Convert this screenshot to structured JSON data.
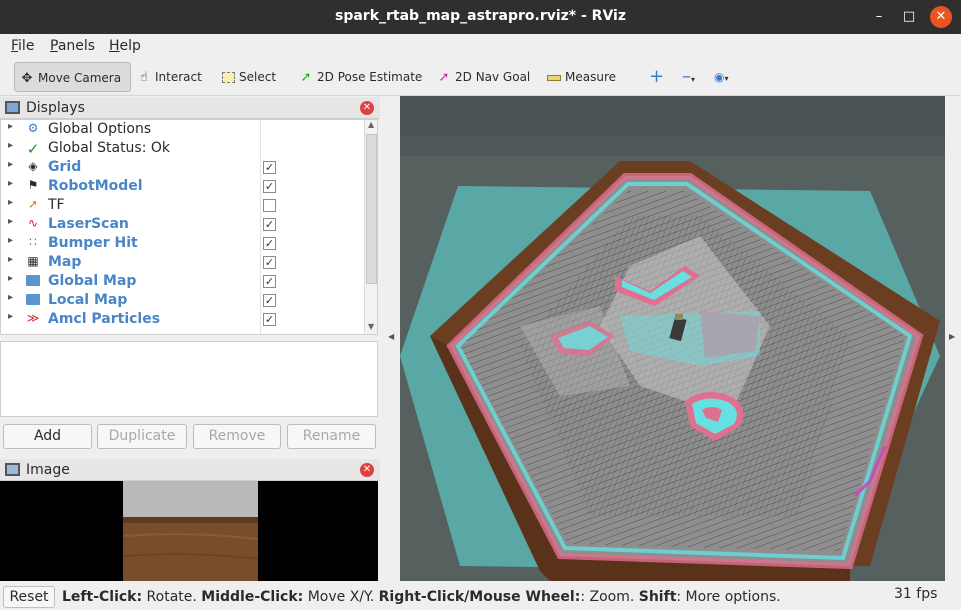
{
  "window": {
    "title": "spark_rtab_map_astrapro.rviz* - RViz"
  },
  "menu": {
    "file": "File",
    "panels": "Panels",
    "help": "Help"
  },
  "toolbar": {
    "move_camera": "Move Camera",
    "interact": "Interact",
    "select": "Select",
    "pose_estimate": "2D Pose Estimate",
    "nav_goal": "2D Nav Goal",
    "measure": "Measure"
  },
  "displays": {
    "title": "Displays",
    "items": [
      {
        "label": "Global Options",
        "icon": "gear-icon",
        "checked": null,
        "link": false
      },
      {
        "label": "Global Status: Ok",
        "icon": "checkmark-icon",
        "checked": null,
        "link": false
      },
      {
        "label": "Grid",
        "icon": "grid-icon",
        "checked": true,
        "link": true
      },
      {
        "label": "RobotModel",
        "icon": "robot-icon",
        "checked": true,
        "link": true
      },
      {
        "label": "TF",
        "icon": "axes-icon",
        "checked": false,
        "link": false
      },
      {
        "label": "LaserScan",
        "icon": "laser-icon",
        "checked": true,
        "link": true
      },
      {
        "label": "Bumper Hit",
        "icon": "points-icon",
        "checked": true,
        "link": true
      },
      {
        "label": "Map",
        "icon": "map-icon",
        "checked": true,
        "link": true
      },
      {
        "label": "Global Map",
        "icon": "folder-icon",
        "checked": true,
        "link": true
      },
      {
        "label": "Local Map",
        "icon": "folder-icon",
        "checked": true,
        "link": true
      },
      {
        "label": "Amcl Particles",
        "icon": "particles-icon",
        "checked": true,
        "link": true
      }
    ],
    "buttons": {
      "add": "Add",
      "duplicate": "Duplicate",
      "remove": "Remove",
      "rename": "Rename"
    }
  },
  "image_panel": {
    "title": "Image"
  },
  "status": {
    "reset": "Reset",
    "hint": [
      {
        "bold": "Left-Click:",
        "text": " Rotate. "
      },
      {
        "bold": "Middle-Click:",
        "text": " Move X/Y. "
      },
      {
        "bold": "Right-Click/Mouse Wheel:",
        "text": ": Zoom. "
      },
      {
        "bold": "Shift",
        "text": ": More options."
      }
    ],
    "fps": "31 fps"
  },
  "colors": {
    "title_bar": "#2f2f2f",
    "close_button": "#e95420",
    "view_background": "#4b5456",
    "map_floor": "#8a8a8a",
    "link_text": "#4a86c7",
    "costmap_cyan": "#66e0e0",
    "costmap_pink": "#e07090",
    "wall_brown": "#6b3e22"
  }
}
